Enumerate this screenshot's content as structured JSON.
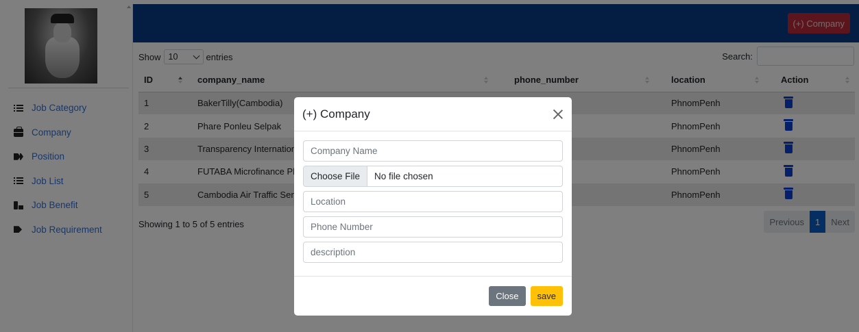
{
  "header": {
    "add_company_label": "(+) Company"
  },
  "sidebar": {
    "items": [
      {
        "label": "Job Category",
        "icon": "list-check-icon"
      },
      {
        "label": "Company",
        "icon": "briefcase-icon"
      },
      {
        "label": "Position",
        "icon": "tags-icon"
      },
      {
        "label": "Job List",
        "icon": "list-icon"
      },
      {
        "label": "Job Benefit",
        "icon": "benefit-icon"
      },
      {
        "label": "Job Requirement",
        "icon": "tag-icon"
      }
    ]
  },
  "table": {
    "show_label": "Show",
    "length_value": "10",
    "entries_label": "entries",
    "search_label": "Search:",
    "search_value": "",
    "columns": [
      "ID",
      "company_name",
      "phone_number",
      "location",
      "Action"
    ],
    "rows": [
      {
        "id": "1",
        "company_name": "BakerTilly(Cambodia)",
        "phone_number": "",
        "location": "PhnomPenh"
      },
      {
        "id": "2",
        "company_name": "Phare Ponleu Selpak",
        "phone_number": "",
        "location": "PhnomPenh"
      },
      {
        "id": "3",
        "company_name": "Transparency Internation",
        "phone_number": "",
        "location": "PhnomPenh"
      },
      {
        "id": "4",
        "company_name": "FUTABA Microfinance Pl",
        "phone_number": "",
        "location": "PhnomPenh"
      },
      {
        "id": "5",
        "company_name": "Cambodia Air Traffic Serv",
        "phone_number": "",
        "location": "PhnomPenh"
      }
    ],
    "info": "Showing 1 to 5 of 5 entries",
    "pager": {
      "previous": "Previous",
      "current": "1",
      "next": "Next"
    }
  },
  "modal": {
    "title": "(+) Company",
    "company_name_placeholder": "Company Name",
    "file_button": "Choose File",
    "file_status": "No file chosen",
    "location_placeholder": "Location",
    "phone_placeholder": "Phone Number",
    "description_placeholder": "description",
    "close_label": "Close",
    "save_label": "save"
  },
  "colors": {
    "topbar": "#063a86",
    "add_button": "#b8283a",
    "link": "#2f6fdb",
    "trash": "#0d3fd6",
    "save": "#ffc107",
    "close": "#6c757d"
  }
}
